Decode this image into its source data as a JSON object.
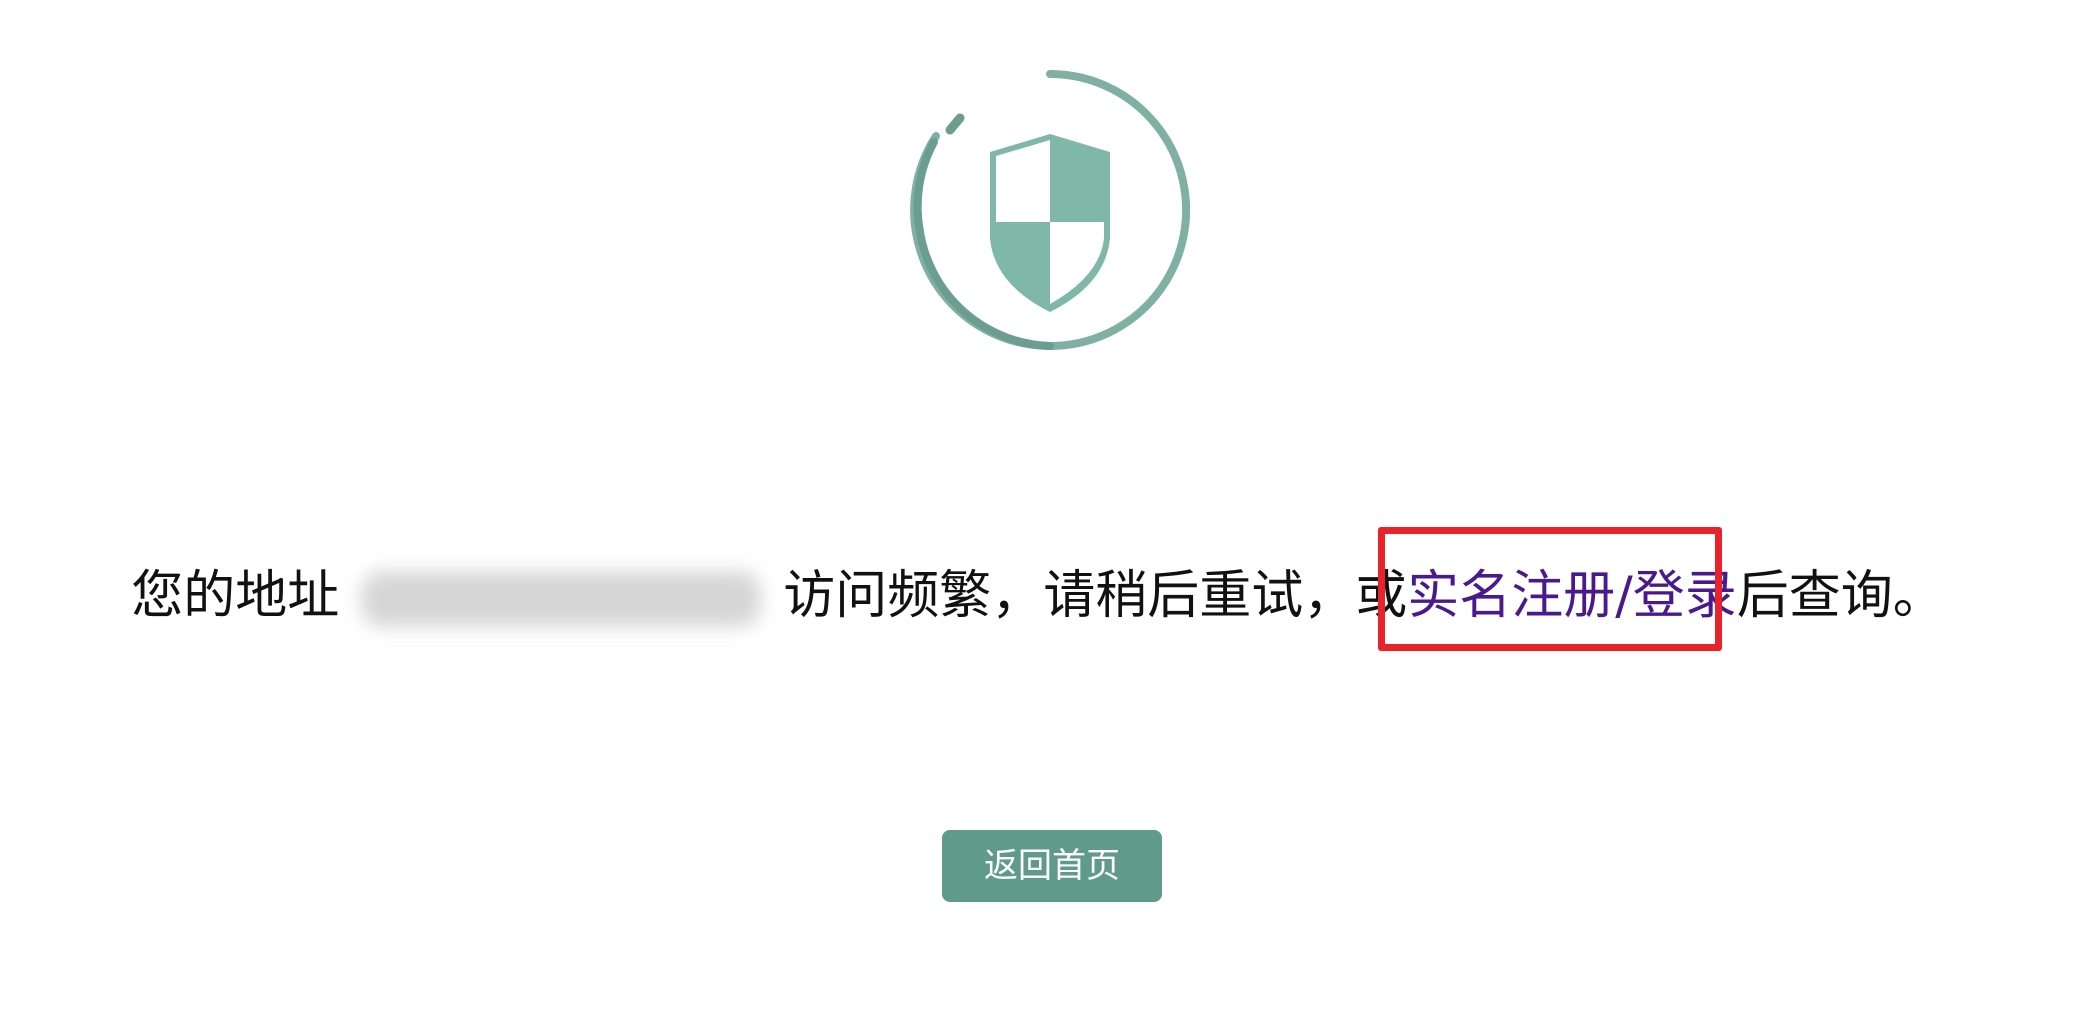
{
  "message": {
    "prefix": "您的地址",
    "middle": "访问频繁，请稍后重试，或",
    "link_label": "实名注册/登录",
    "suffix": "后查询。"
  },
  "button": {
    "home_label": "返回首页"
  },
  "icons": {
    "main": "shield-icon"
  },
  "colors": {
    "accent": "#5f9a8a",
    "link": "#4a1a8c",
    "highlight": "#e8232a"
  }
}
